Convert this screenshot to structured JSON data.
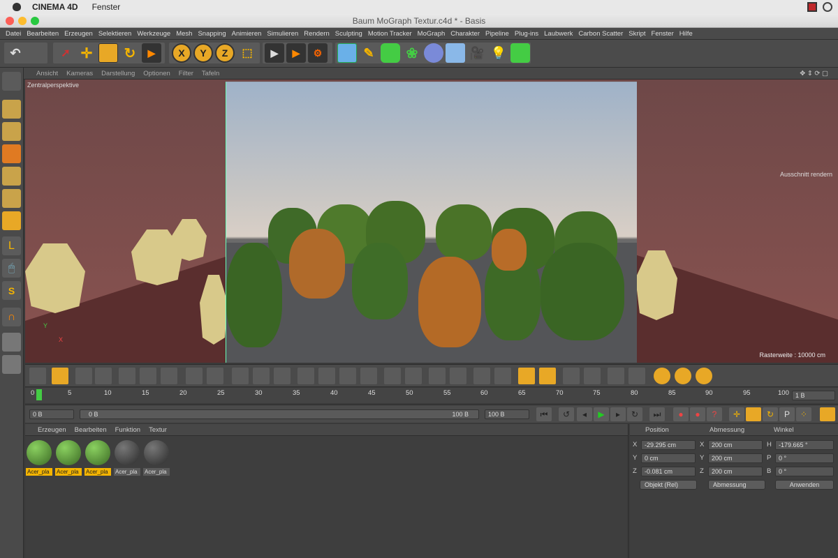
{
  "mac_menu": {
    "app": "CINEMA 4D",
    "items": [
      "Fenster"
    ]
  },
  "window_title": "Baum MoGraph Textur.c4d * - Basis",
  "menu": [
    "Datei",
    "Bearbeiten",
    "Erzeugen",
    "Selektieren",
    "Werkzeuge",
    "Mesh",
    "Snapping",
    "Animieren",
    "Simulieren",
    "Rendern",
    "Sculpting",
    "Motion Tracker",
    "MoGraph",
    "Charakter",
    "Pipeline",
    "Plug-ins",
    "Laubwerk",
    "Carbon Scatter",
    "Skript",
    "Fenster",
    "Hilfe"
  ],
  "toolbar": {
    "axis_x": "X",
    "axis_y": "Y",
    "axis_z": "Z"
  },
  "viewport": {
    "menu": [
      "Ansicht",
      "Kameras",
      "Darstellung",
      "Optionen",
      "Filter",
      "Tafeln"
    ],
    "label": "Zentralperspektive",
    "render_region": "Ausschnitt rendern",
    "grid_info": "Rasterweite : 10000 cm",
    "axis_y": "Y",
    "axis_x": "X"
  },
  "timeline": {
    "ticks": [
      "0",
      "5",
      "10",
      "15",
      "20",
      "25",
      "30",
      "35",
      "40",
      "45",
      "50",
      "55",
      "60",
      "65",
      "70",
      "75",
      "80",
      "85",
      "90",
      "95",
      "100"
    ],
    "end_field": "1 B",
    "start_frame": "0 B",
    "range_start": "0 B",
    "range_end": "100 B",
    "end_frame": "100 B"
  },
  "materials": {
    "menu": [
      "Erzeugen",
      "Bearbeiten",
      "Funktion",
      "Textur"
    ],
    "items": [
      {
        "name": "Acer_pla",
        "selected": true,
        "color": "#5a8a3a"
      },
      {
        "name": "Acer_pla",
        "selected": true,
        "color": "#5a8a3a"
      },
      {
        "name": "Acer_pla",
        "selected": true,
        "color": "#5a8a3a"
      },
      {
        "name": "Acer_pla",
        "selected": false,
        "color": "#555"
      },
      {
        "name": "Acer_pla",
        "selected": false,
        "color": "#555"
      }
    ]
  },
  "coordinates": {
    "headers": {
      "position": "Position",
      "size": "Abmessung",
      "rotation": "Winkel"
    },
    "rows": [
      {
        "axis": "X",
        "pos": "-29.295 cm",
        "size_axis": "X",
        "size": "200 cm",
        "rot_axis": "H",
        "rot": "-179.665 °"
      },
      {
        "axis": "Y",
        "pos": "0 cm",
        "size_axis": "Y",
        "size": "200 cm",
        "rot_axis": "P",
        "rot": "0 °"
      },
      {
        "axis": "Z",
        "pos": "-0.081 cm",
        "size_axis": "Z",
        "size": "200 cm",
        "rot_axis": "B",
        "rot": "0 °"
      }
    ],
    "mode": "Objekt (Rel)",
    "size_mode": "Abmessung",
    "apply": "Anwenden"
  }
}
